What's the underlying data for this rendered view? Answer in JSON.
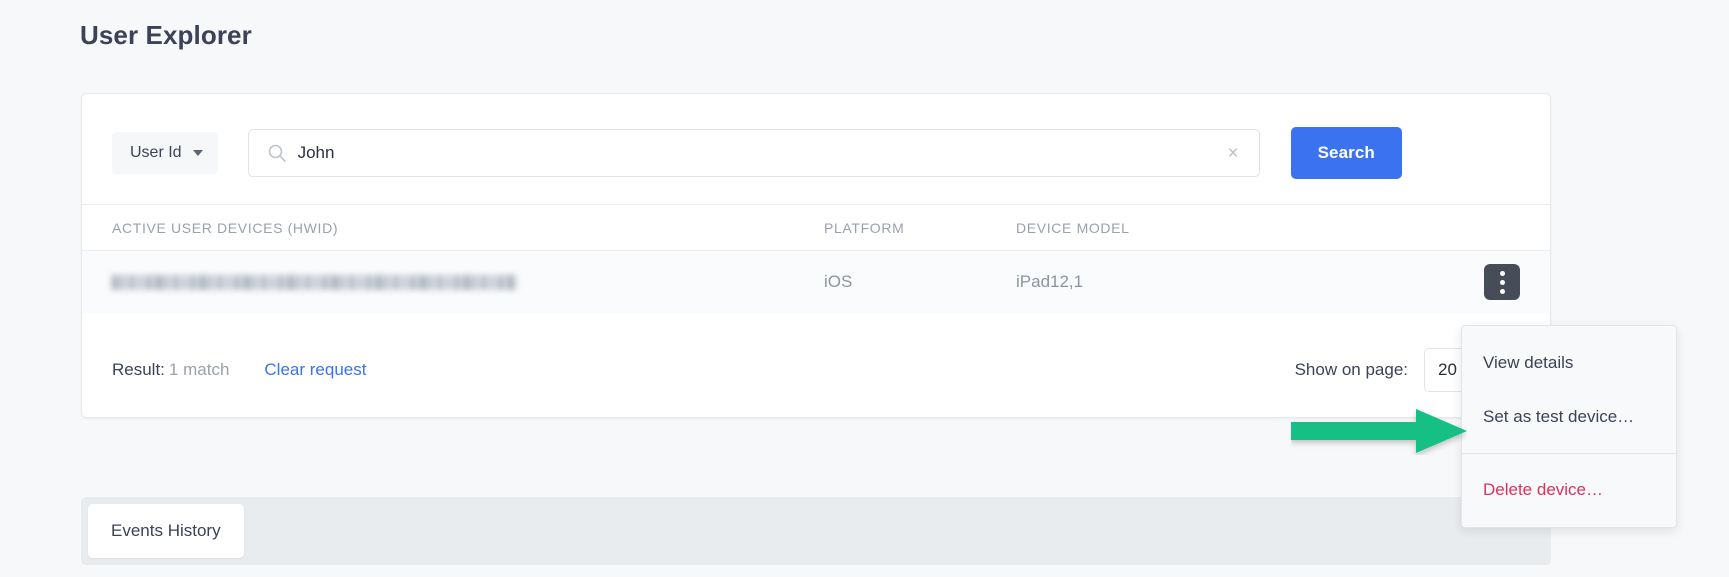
{
  "page": {
    "title": "User Explorer"
  },
  "search": {
    "field_label": "User Id",
    "field_caret_icon": "chevron-down-icon",
    "search_icon": "search-icon",
    "value": "John",
    "placeholder": "",
    "clear_icon": "close-icon",
    "button_label": "Search"
  },
  "table": {
    "columns": [
      {
        "key": "hwid",
        "label": "ACTIVE USER DEVICES (HWID)"
      },
      {
        "key": "platform",
        "label": "PLATFORM"
      },
      {
        "key": "model",
        "label": "DEVICE MODEL"
      }
    ],
    "rows": [
      {
        "hwid": "",
        "hwid_redacted": true,
        "platform": "iOS",
        "model": "iPad12,1",
        "actions_icon": "kebab-menu-icon"
      }
    ]
  },
  "footer": {
    "result_label": "Result:",
    "result_count": "1 match",
    "clear_request_label": "Clear request",
    "show_on_page_label": "Show on page:",
    "page_size_value": "20"
  },
  "context_menu": {
    "items": [
      {
        "label": "View details",
        "danger": false
      },
      {
        "label": "Set as test device…",
        "danger": false
      },
      {
        "label": "Delete device…",
        "danger": true
      }
    ]
  },
  "tabs": {
    "items": [
      {
        "label": "Events History",
        "active": true
      }
    ]
  },
  "annotation": {
    "arrow_icon": "arrow-right-icon",
    "arrow_color": "#16c084"
  },
  "colors": {
    "accent_blue": "#3a72ef",
    "danger_red": "#e0315b",
    "annotation_green": "#16c084",
    "page_bg": "#f7f8fa",
    "text_primary": "#3c4257",
    "text_muted": "#9aa1ad"
  }
}
